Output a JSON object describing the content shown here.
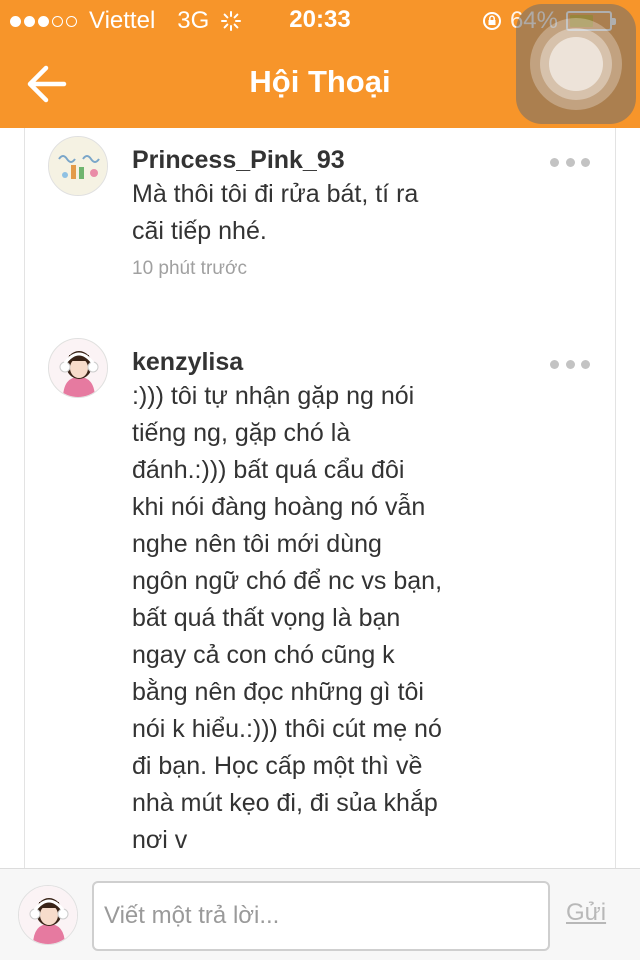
{
  "status_bar": {
    "carrier": "Viettel",
    "network": "3G",
    "time": "20:33",
    "battery": "64%",
    "battery_level": 0.64,
    "signal_bars": 3,
    "signal_total": 5
  },
  "nav": {
    "title": "Hội Thoại",
    "back_icon": "arrow-left-icon",
    "color": "#f7952a"
  },
  "comments": [
    {
      "author": "Princess_Pink_93",
      "message": "Mà thôi tôi đi rửa bát, tí ra cãi tiếp nhé.",
      "time": "10 phút trước"
    },
    {
      "author": "kenzylisa",
      "message": ":))) tôi tự nhận gặp ng nói tiếng ng, gặp chó là đánh.:))) bất quá cẩu đôi khi nói đàng hoàng nó vẫn nghe nên tôi mới dùng ngôn ngữ chó để nc vs bạn, bất quá thất vọng là bạn ngay cả con chó cũng k bằng nên đọc những gì tôi nói k hiểu.:))) thôi cút mẹ nó đi bạn. Học cấp một thì về nhà mút kẹo đi, đi sủa khắp nơi v"
    }
  ],
  "reply": {
    "placeholder": "Viết một trả lời...",
    "send_label": "Gửi"
  }
}
